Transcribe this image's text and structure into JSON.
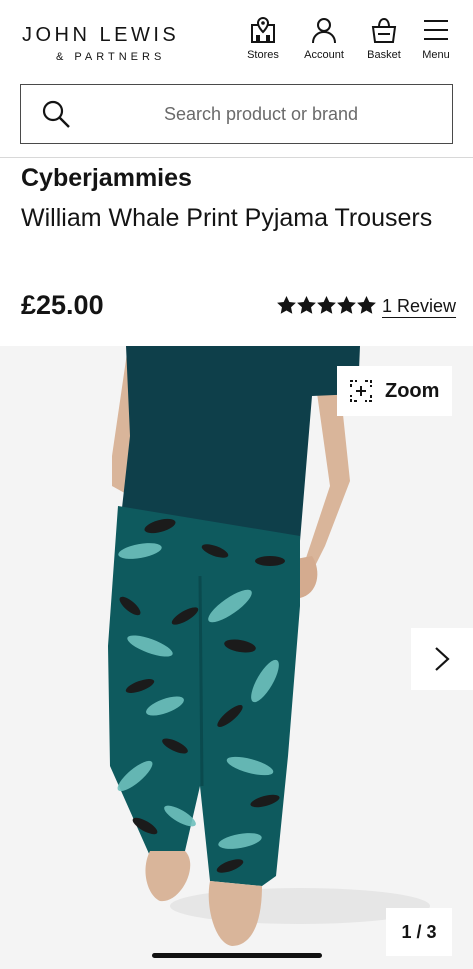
{
  "header": {
    "logo_main": "JOHN LEWIS",
    "logo_sub": "& PARTNERS",
    "nav": [
      {
        "label": "Stores",
        "icon": "store-icon"
      },
      {
        "label": "Account",
        "icon": "account-icon"
      },
      {
        "label": "Basket",
        "icon": "basket-icon"
      },
      {
        "label": "Menu",
        "icon": "menu-icon"
      }
    ]
  },
  "search": {
    "placeholder": "Search product or brand"
  },
  "product": {
    "brand": "Cyberjammies",
    "title": "William Whale Print Pyjama Trousers",
    "price": "£25.00",
    "rating": 5,
    "review_link": "1 Review"
  },
  "gallery": {
    "zoom_label": "Zoom",
    "counter": "1 / 3"
  },
  "colors": {
    "text": "#141414",
    "gallery_bg": "#f4f4f4",
    "tshirt": "#0e3f4a",
    "trousers": "#0e5a5e",
    "whale": "#6ec1bd"
  }
}
